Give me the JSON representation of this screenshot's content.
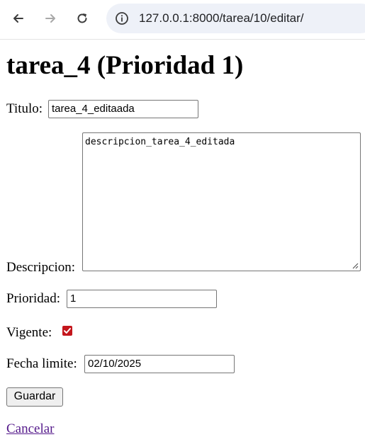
{
  "browser": {
    "url": "127.0.0.1:8000/tarea/10/editar/"
  },
  "page": {
    "heading": "tarea_4 (Prioridad 1)"
  },
  "form": {
    "titulo_label": "Titulo:",
    "titulo_value": "tarea_4_editaada",
    "descripcion_label": "Descripcion:",
    "descripcion_value": "descripcion_tarea_4_editada",
    "prioridad_label": "Prioridad:",
    "prioridad_value": "1",
    "vigente_label": "Vigente:",
    "vigente_checked": true,
    "fecha_label": "Fecha limite:",
    "fecha_value": "02/10/2025",
    "guardar_label": "Guardar",
    "cancelar_label": "Cancelar"
  },
  "colors": {
    "checkbox": "#c4161c",
    "link_visited": "#551a8b",
    "address_bar_bg": "#eef1f8"
  }
}
